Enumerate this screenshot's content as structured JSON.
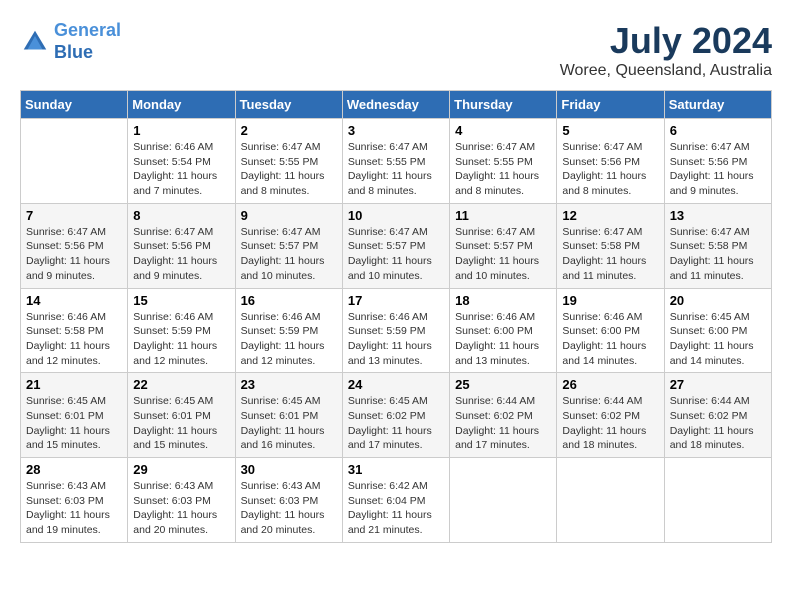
{
  "header": {
    "logo_line1": "General",
    "logo_line2": "Blue",
    "month_title": "July 2024",
    "location": "Woree, Queensland, Australia"
  },
  "days_of_week": [
    "Sunday",
    "Monday",
    "Tuesday",
    "Wednesday",
    "Thursday",
    "Friday",
    "Saturday"
  ],
  "weeks": [
    [
      {
        "day": "",
        "sunrise": "",
        "sunset": "",
        "daylight": ""
      },
      {
        "day": "1",
        "sunrise": "Sunrise: 6:46 AM",
        "sunset": "Sunset: 5:54 PM",
        "daylight": "Daylight: 11 hours and 7 minutes."
      },
      {
        "day": "2",
        "sunrise": "Sunrise: 6:47 AM",
        "sunset": "Sunset: 5:55 PM",
        "daylight": "Daylight: 11 hours and 8 minutes."
      },
      {
        "day": "3",
        "sunrise": "Sunrise: 6:47 AM",
        "sunset": "Sunset: 5:55 PM",
        "daylight": "Daylight: 11 hours and 8 minutes."
      },
      {
        "day": "4",
        "sunrise": "Sunrise: 6:47 AM",
        "sunset": "Sunset: 5:55 PM",
        "daylight": "Daylight: 11 hours and 8 minutes."
      },
      {
        "day": "5",
        "sunrise": "Sunrise: 6:47 AM",
        "sunset": "Sunset: 5:56 PM",
        "daylight": "Daylight: 11 hours and 8 minutes."
      },
      {
        "day": "6",
        "sunrise": "Sunrise: 6:47 AM",
        "sunset": "Sunset: 5:56 PM",
        "daylight": "Daylight: 11 hours and 9 minutes."
      }
    ],
    [
      {
        "day": "7",
        "sunrise": "Sunrise: 6:47 AM",
        "sunset": "Sunset: 5:56 PM",
        "daylight": "Daylight: 11 hours and 9 minutes."
      },
      {
        "day": "8",
        "sunrise": "Sunrise: 6:47 AM",
        "sunset": "Sunset: 5:56 PM",
        "daylight": "Daylight: 11 hours and 9 minutes."
      },
      {
        "day": "9",
        "sunrise": "Sunrise: 6:47 AM",
        "sunset": "Sunset: 5:57 PM",
        "daylight": "Daylight: 11 hours and 10 minutes."
      },
      {
        "day": "10",
        "sunrise": "Sunrise: 6:47 AM",
        "sunset": "Sunset: 5:57 PM",
        "daylight": "Daylight: 11 hours and 10 minutes."
      },
      {
        "day": "11",
        "sunrise": "Sunrise: 6:47 AM",
        "sunset": "Sunset: 5:57 PM",
        "daylight": "Daylight: 11 hours and 10 minutes."
      },
      {
        "day": "12",
        "sunrise": "Sunrise: 6:47 AM",
        "sunset": "Sunset: 5:58 PM",
        "daylight": "Daylight: 11 hours and 11 minutes."
      },
      {
        "day": "13",
        "sunrise": "Sunrise: 6:47 AM",
        "sunset": "Sunset: 5:58 PM",
        "daylight": "Daylight: 11 hours and 11 minutes."
      }
    ],
    [
      {
        "day": "14",
        "sunrise": "Sunrise: 6:46 AM",
        "sunset": "Sunset: 5:58 PM",
        "daylight": "Daylight: 11 hours and 12 minutes."
      },
      {
        "day": "15",
        "sunrise": "Sunrise: 6:46 AM",
        "sunset": "Sunset: 5:59 PM",
        "daylight": "Daylight: 11 hours and 12 minutes."
      },
      {
        "day": "16",
        "sunrise": "Sunrise: 6:46 AM",
        "sunset": "Sunset: 5:59 PM",
        "daylight": "Daylight: 11 hours and 12 minutes."
      },
      {
        "day": "17",
        "sunrise": "Sunrise: 6:46 AM",
        "sunset": "Sunset: 5:59 PM",
        "daylight": "Daylight: 11 hours and 13 minutes."
      },
      {
        "day": "18",
        "sunrise": "Sunrise: 6:46 AM",
        "sunset": "Sunset: 6:00 PM",
        "daylight": "Daylight: 11 hours and 13 minutes."
      },
      {
        "day": "19",
        "sunrise": "Sunrise: 6:46 AM",
        "sunset": "Sunset: 6:00 PM",
        "daylight": "Daylight: 11 hours and 14 minutes."
      },
      {
        "day": "20",
        "sunrise": "Sunrise: 6:45 AM",
        "sunset": "Sunset: 6:00 PM",
        "daylight": "Daylight: 11 hours and 14 minutes."
      }
    ],
    [
      {
        "day": "21",
        "sunrise": "Sunrise: 6:45 AM",
        "sunset": "Sunset: 6:01 PM",
        "daylight": "Daylight: 11 hours and 15 minutes."
      },
      {
        "day": "22",
        "sunrise": "Sunrise: 6:45 AM",
        "sunset": "Sunset: 6:01 PM",
        "daylight": "Daylight: 11 hours and 15 minutes."
      },
      {
        "day": "23",
        "sunrise": "Sunrise: 6:45 AM",
        "sunset": "Sunset: 6:01 PM",
        "daylight": "Daylight: 11 hours and 16 minutes."
      },
      {
        "day": "24",
        "sunrise": "Sunrise: 6:45 AM",
        "sunset": "Sunset: 6:02 PM",
        "daylight": "Daylight: 11 hours and 17 minutes."
      },
      {
        "day": "25",
        "sunrise": "Sunrise: 6:44 AM",
        "sunset": "Sunset: 6:02 PM",
        "daylight": "Daylight: 11 hours and 17 minutes."
      },
      {
        "day": "26",
        "sunrise": "Sunrise: 6:44 AM",
        "sunset": "Sunset: 6:02 PM",
        "daylight": "Daylight: 11 hours and 18 minutes."
      },
      {
        "day": "27",
        "sunrise": "Sunrise: 6:44 AM",
        "sunset": "Sunset: 6:02 PM",
        "daylight": "Daylight: 11 hours and 18 minutes."
      }
    ],
    [
      {
        "day": "28",
        "sunrise": "Sunrise: 6:43 AM",
        "sunset": "Sunset: 6:03 PM",
        "daylight": "Daylight: 11 hours and 19 minutes."
      },
      {
        "day": "29",
        "sunrise": "Sunrise: 6:43 AM",
        "sunset": "Sunset: 6:03 PM",
        "daylight": "Daylight: 11 hours and 20 minutes."
      },
      {
        "day": "30",
        "sunrise": "Sunrise: 6:43 AM",
        "sunset": "Sunset: 6:03 PM",
        "daylight": "Daylight: 11 hours and 20 minutes."
      },
      {
        "day": "31",
        "sunrise": "Sunrise: 6:42 AM",
        "sunset": "Sunset: 6:04 PM",
        "daylight": "Daylight: 11 hours and 21 minutes."
      },
      {
        "day": "",
        "sunrise": "",
        "sunset": "",
        "daylight": ""
      },
      {
        "day": "",
        "sunrise": "",
        "sunset": "",
        "daylight": ""
      },
      {
        "day": "",
        "sunrise": "",
        "sunset": "",
        "daylight": ""
      }
    ]
  ]
}
